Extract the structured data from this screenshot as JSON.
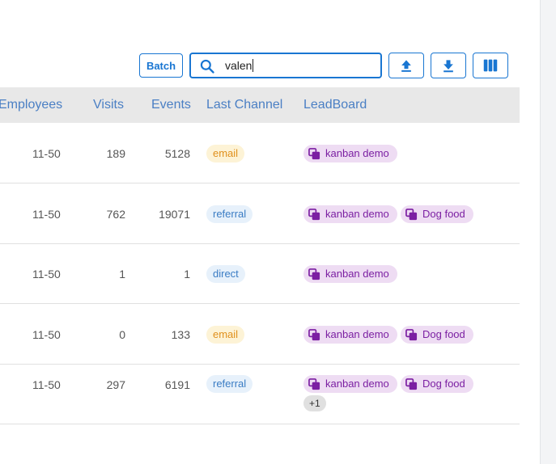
{
  "toolbar": {
    "batch_label": "Batch",
    "search_value": "valen"
  },
  "table": {
    "headers": {
      "employees": "Employees",
      "visits": "Visits",
      "events": "Events",
      "last_channel": "Last Channel",
      "leadboard": "LeadBoard"
    },
    "rows": [
      {
        "employees": "11-50",
        "visits": "189",
        "events": "5128",
        "channel": "email",
        "boards": [
          "kanban demo"
        ]
      },
      {
        "employees": "11-50",
        "visits": "762",
        "events": "19071",
        "channel": "referral",
        "boards": [
          "kanban demo",
          "Dog food"
        ]
      },
      {
        "employees": "11-50",
        "visits": "1",
        "events": "1",
        "channel": "direct",
        "boards": [
          "kanban demo"
        ]
      },
      {
        "employees": "11-50",
        "visits": "0",
        "events": "133",
        "channel": "email",
        "boards": [
          "kanban demo",
          "Dog food"
        ]
      },
      {
        "employees": "11-50",
        "visits": "297",
        "events": "6191",
        "channel": "referral",
        "boards": [
          "kanban demo",
          "Dog food"
        ],
        "more": "+1"
      }
    ]
  },
  "colors": {
    "accent": "#1976d2",
    "header_text": "#4a7fc4",
    "email_bg": "#fdf3d6",
    "referral_bg": "#e7f1fb",
    "board_bg": "#eedcf3",
    "board_text": "#7b1fa2"
  },
  "icons": {
    "search": "search-icon",
    "upload": "upload-icon",
    "download": "download-icon",
    "columns": "columns-icon",
    "board": "board-copy-icon"
  }
}
